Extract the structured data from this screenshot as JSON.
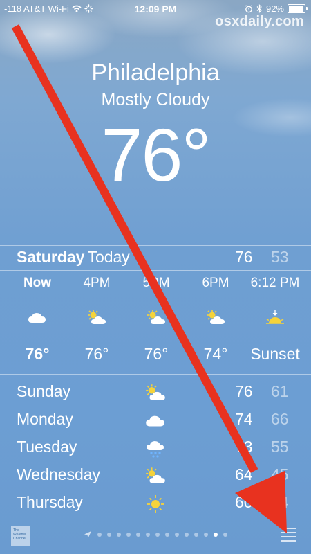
{
  "status": {
    "signal": "-118 AT&T Wi-Fi",
    "time": "12:09 PM",
    "battery": "92%",
    "battery_level": 0.92
  },
  "watermark": "osxdaily.com",
  "location": {
    "city": "Philadelphia",
    "condition": "Mostly Cloudy",
    "temp": "76°"
  },
  "today": {
    "day": "Saturday",
    "label": "Today",
    "hi": "76",
    "lo": "53"
  },
  "hourly": [
    {
      "time": "Now",
      "icon": "cloud-icon",
      "temp": "76°"
    },
    {
      "time": "4PM",
      "icon": "partly-sunny-icon",
      "temp": "76°"
    },
    {
      "time": "5PM",
      "icon": "partly-sunny-icon",
      "temp": "76°"
    },
    {
      "time": "6PM",
      "icon": "partly-sunny-icon",
      "temp": "74°"
    },
    {
      "time": "6:12 PM",
      "icon": "sunset-icon",
      "temp": "Sunset"
    }
  ],
  "daily": [
    {
      "day": "Sunday",
      "icon": "partly-sunny-icon",
      "hi": "76",
      "lo": "61"
    },
    {
      "day": "Monday",
      "icon": "cloud-icon",
      "hi": "74",
      "lo": "66"
    },
    {
      "day": "Tuesday",
      "icon": "rain-icon",
      "hi": "73",
      "lo": "55"
    },
    {
      "day": "Wednesday",
      "icon": "partly-sunny-icon",
      "hi": "64",
      "lo": "45"
    },
    {
      "day": "Thursday",
      "icon": "sun-icon",
      "hi": "60",
      "lo": "44"
    }
  ],
  "bottom": {
    "logo_text": "The Weather Channel",
    "page_count": 14,
    "active_page": 13
  },
  "colors": {
    "sky": "#6c9ed3",
    "arrow": "#e8321f"
  }
}
